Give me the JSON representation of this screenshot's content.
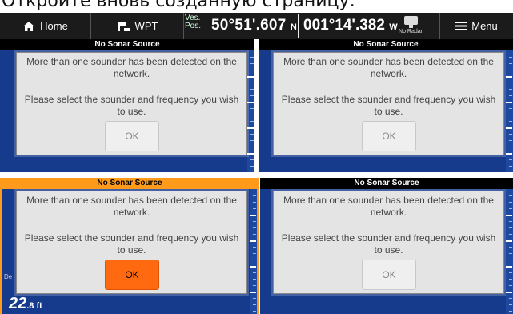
{
  "caption": "Откройте вновь созданную страницу:",
  "topbar": {
    "home_label": "Home",
    "wpt_label": "WPT",
    "ves_pos_label": "Ves. Pos.",
    "lat": "50°51'.607",
    "lat_hemi": "N",
    "lon": "001°14'.382",
    "lon_hemi": "W",
    "radar_label": "No Radar",
    "menu_label": "Menu",
    "icons": [
      "home-icon",
      "waypoint-icon",
      "radar-icon",
      "menu-icon"
    ]
  },
  "panes": [
    {
      "title": "No Sonar Source",
      "message1": "More than one sounder has been detected on the network.",
      "message2": "Please select the sounder and frequency you wish to use.",
      "ok": "OK"
    },
    {
      "title": "No Sonar Source",
      "message1": "More than one sounder has been detected on the network.",
      "message2": "Please select the sounder and frequency you wish to use.",
      "ok": "OK"
    },
    {
      "title": "No Sonar Source",
      "message1": "More than one sounder has been detected on the network.",
      "message2": "Please select the sounder and frequency you wish to use.",
      "ok": "OK"
    },
    {
      "title": "No Sonar Source",
      "message1": "More than one sounder has been detected on the network.",
      "message2": "Please select the sounder and frequency you wish to use.",
      "ok": "OK"
    }
  ],
  "depth": {
    "value": "22",
    "unit": ".8 ft",
    "label": "De"
  },
  "colors": {
    "active": "#ff9a1a",
    "ok_focus": "#ff6a10",
    "pane_bg": "#163a8c"
  }
}
